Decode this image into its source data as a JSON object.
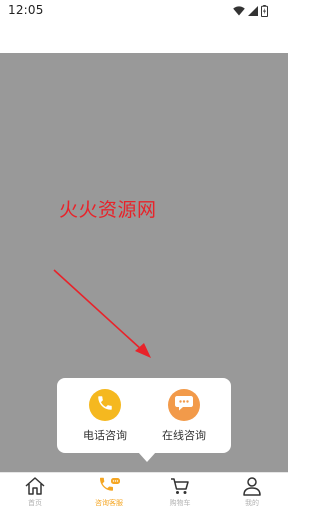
{
  "status_bar": {
    "time": "12:05"
  },
  "watermark": {
    "text": "火火资源网"
  },
  "popup": {
    "options": [
      {
        "label": "电话咨询",
        "icon": "phone-icon",
        "color": "#F5B81F"
      },
      {
        "label": "在线咨询",
        "icon": "chat-bubble-icon",
        "color": "#F29A4A"
      }
    ]
  },
  "tabbar": {
    "items": [
      {
        "label": "首页",
        "icon": "home-icon"
      },
      {
        "label": "咨询客服",
        "icon": "phone-chat-icon",
        "active": true
      },
      {
        "label": "购物车",
        "icon": "cart-icon"
      },
      {
        "label": "我的",
        "icon": "user-icon"
      }
    ]
  },
  "colors": {
    "overlay": "#999999",
    "watermark": "#E8232A",
    "arrow": "#E8232A",
    "accent": "#F5A623",
    "tab_inactive": "#B2B2B2"
  }
}
